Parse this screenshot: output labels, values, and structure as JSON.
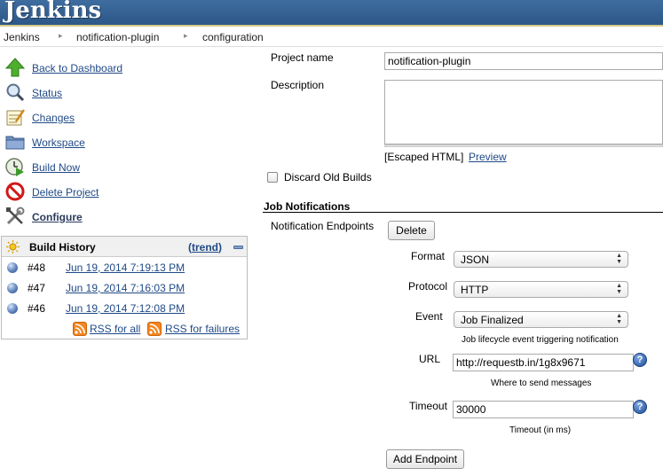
{
  "header": {
    "logo_text": "Jenkins"
  },
  "breadcrumb": [
    {
      "label": "Jenkins"
    },
    {
      "label": "notification-plugin"
    },
    {
      "label": "configuration"
    }
  ],
  "sidebar": {
    "tasks": [
      {
        "label": "Back to Dashboard",
        "icon": "up-arrow-icon"
      },
      {
        "label": "Status",
        "icon": "search-icon"
      },
      {
        "label": "Changes",
        "icon": "notepad-icon"
      },
      {
        "label": "Workspace",
        "icon": "folder-icon"
      },
      {
        "label": "Build Now",
        "icon": "clock-play-icon"
      },
      {
        "label": "Delete Project",
        "icon": "no-entry-icon"
      },
      {
        "label": "Configure",
        "icon": "tools-icon"
      }
    ]
  },
  "build_history": {
    "title": "Build History",
    "trend_open": "(",
    "trend_label": "trend",
    "trend_close": ")",
    "builds": [
      {
        "number": "#48",
        "date": "Jun 19, 2014 7:19:13 PM"
      },
      {
        "number": "#47",
        "date": "Jun 19, 2014 7:16:03 PM"
      },
      {
        "number": "#46",
        "date": "Jun 19, 2014 7:12:08 PM"
      }
    ],
    "rss_all": "RSS for all",
    "rss_failures": "RSS for failures"
  },
  "config": {
    "project_name_label": "Project name",
    "project_name_value": "notification-plugin",
    "description_label": "Description",
    "description_value": "",
    "escaped_html": "[Escaped HTML]",
    "preview_label": "Preview",
    "discard_label": "Discard Old Builds",
    "discard_checked": false
  },
  "notifications": {
    "section_title": "Job Notifications",
    "endpoints_label": "Notification Endpoints",
    "delete_button": "Delete",
    "format_label": "Format",
    "format_value": "JSON",
    "protocol_label": "Protocol",
    "protocol_value": "HTTP",
    "event_label": "Event",
    "event_value": "Job Finalized",
    "event_hint": "Job lifecycle event triggering notification",
    "url_label": "URL",
    "url_value": "http://requestb.in/1g8x9671",
    "url_hint": "Where to send messages",
    "timeout_label": "Timeout",
    "timeout_value": "30000",
    "timeout_hint": "Timeout (in ms)",
    "help_glyph": "?",
    "add_endpoint_button": "Add Endpoint"
  }
}
